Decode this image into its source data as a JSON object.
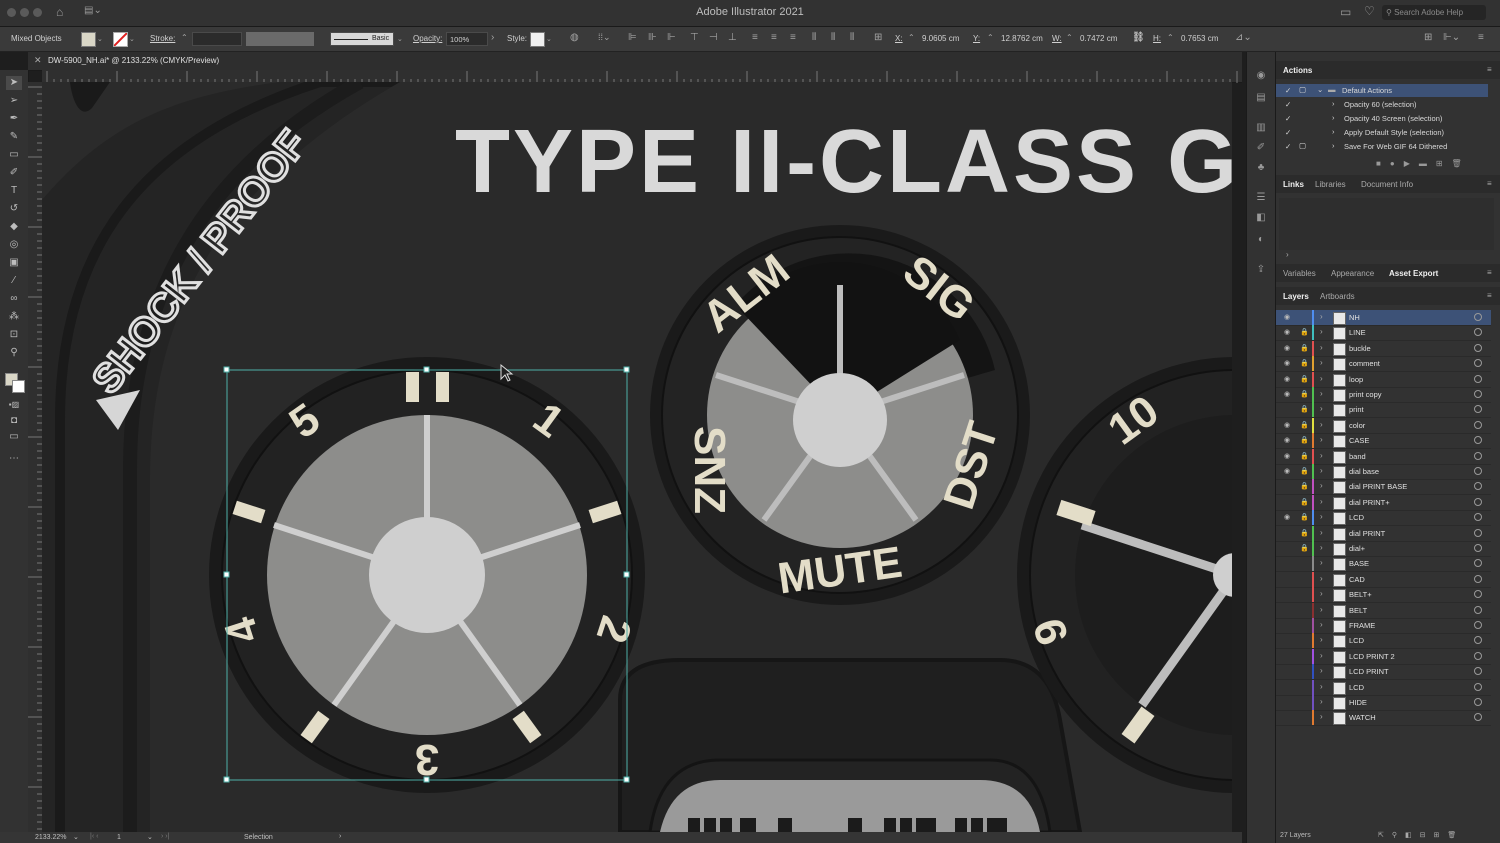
{
  "app": {
    "title": "Adobe Illustrator 2021",
    "search_placeholder": "Search Adobe Help"
  },
  "control_bar": {
    "selection": "Mixed Objects",
    "stroke_label": "Stroke:",
    "brush_label": "Basic",
    "opacity_label": "Opacity:",
    "opacity_value": "100%",
    "style_label": "Style:",
    "x_label": "X:",
    "x_value": "9.0605 cm",
    "y_label": "Y:",
    "y_value": "12.8762 cm",
    "w_label": "W:",
    "w_value": "0.7472 cm",
    "h_label": "H:",
    "h_value": "0.7653 cm"
  },
  "document": {
    "tab_label": "DW-5900_NH.ai* @ 2133.22% (CMYK/Preview)"
  },
  "status": {
    "zoom": "2133.22%",
    "artboard": "1",
    "tool": "Selection"
  },
  "artwork": {
    "headline": "TYPE II-CLASS G",
    "side_text": "SHOCK / PROOF",
    "left_dial_numbers": [
      "5",
      "1",
      "2",
      "3",
      "4"
    ],
    "left_dial_top_mark": "II",
    "center_dial_labels": [
      "ALM",
      "SIG",
      "DST",
      "MUTE",
      "SNZ"
    ],
    "right_dial_numbers": [
      "10",
      "9"
    ]
  },
  "actions_panel": {
    "title": "Actions",
    "items": [
      {
        "label": "Default Actions",
        "selected": true
      },
      {
        "label": "Opacity 60 (selection)"
      },
      {
        "label": "Opacity 40 Screen (selection)"
      },
      {
        "label": "Apply Default Style (selection)"
      },
      {
        "label": "Save For Web GIF 64 Dithered"
      }
    ]
  },
  "links_panel": {
    "tabs": [
      "Links",
      "Libraries",
      "Document Info"
    ]
  },
  "mid_panel": {
    "tabs": [
      "Variables",
      "Appearance",
      "Asset Export"
    ]
  },
  "layers_panel": {
    "tabs": [
      "Layers",
      "Artboards"
    ],
    "layers": [
      {
        "name": "NH",
        "color": "#4f8ef0",
        "visible": true,
        "locked": false,
        "selected": true
      },
      {
        "name": "LINE",
        "color": "#3fbfbf",
        "visible": true,
        "locked": true
      },
      {
        "name": "buckle",
        "color": "#e05050",
        "visible": true,
        "locked": true
      },
      {
        "name": "comment",
        "color": "#e0a030",
        "visible": true,
        "locked": true
      },
      {
        "name": "loop",
        "color": "#e05050",
        "visible": true,
        "locked": true
      },
      {
        "name": "print copy",
        "color": "#50c050",
        "visible": true,
        "locked": true
      },
      {
        "name": "print",
        "color": "#50c050",
        "visible": false,
        "locked": true
      },
      {
        "name": "color",
        "color": "#e0e040",
        "visible": true,
        "locked": true
      },
      {
        "name": "CASE",
        "color": "#e07a30",
        "visible": true,
        "locked": true
      },
      {
        "name": "band",
        "color": "#e05050",
        "visible": true,
        "locked": true
      },
      {
        "name": "dial base",
        "color": "#50c050",
        "visible": true,
        "locked": true
      },
      {
        "name": "dial PRINT BASE",
        "color": "#c050c0",
        "visible": false,
        "locked": true
      },
      {
        "name": "dial PRINT+",
        "color": "#c050c0",
        "visible": false,
        "locked": true
      },
      {
        "name": "LCD",
        "color": "#4f8ef0",
        "visible": true,
        "locked": true
      },
      {
        "name": "dial PRINT",
        "color": "#50c050",
        "visible": false,
        "locked": true
      },
      {
        "name": "dial+",
        "color": "#50c050",
        "visible": false,
        "locked": true
      },
      {
        "name": "BASE",
        "color": "#8a8a8a",
        "visible": false,
        "locked": false
      },
      {
        "name": "CAD",
        "color": "#e05050",
        "visible": false,
        "locked": false
      },
      {
        "name": "BELT+",
        "color": "#e05050",
        "visible": false,
        "locked": false
      },
      {
        "name": "BELT",
        "color": "#8a3030",
        "visible": false,
        "locked": false
      },
      {
        "name": "FRAME",
        "color": "#a050a0",
        "visible": false,
        "locked": false
      },
      {
        "name": "LCD",
        "color": "#e07a30",
        "visible": false,
        "locked": false
      },
      {
        "name": "LCD PRINT 2",
        "color": "#a050e0",
        "visible": false,
        "locked": false
      },
      {
        "name": "LCD PRINT",
        "color": "#3050c0",
        "visible": false,
        "locked": false
      },
      {
        "name": "LCD",
        "color": "#7050c0",
        "visible": false,
        "locked": false
      },
      {
        "name": "HIDE",
        "color": "#7050c0",
        "visible": false,
        "locked": false
      },
      {
        "name": "WATCH",
        "color": "#e07a30",
        "visible": false,
        "locked": false
      }
    ],
    "count_label": "27 Layers"
  }
}
